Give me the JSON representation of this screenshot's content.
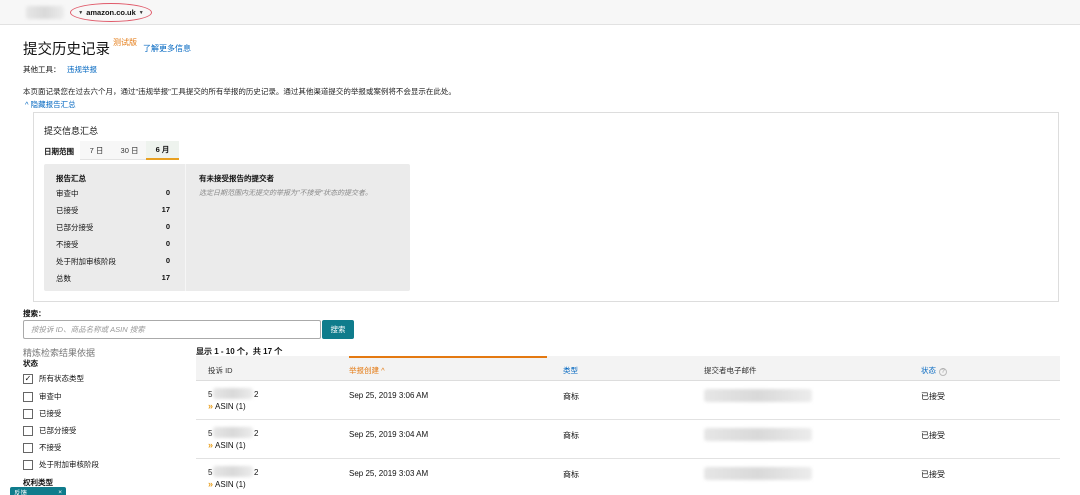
{
  "topbar": {
    "marketplace": "amazon.co.uk"
  },
  "page": {
    "title": "提交历史记录",
    "beta_badge": "测试版",
    "learn_more": "了解更多信息",
    "other_tools_label": "其他工具：",
    "other_tools_link": "违规举报",
    "description": "本页面记录您在过去六个月，通过\"违规举报\"工具提交的所有举报的历史记录。通过其他渠道提交的举报或案例将不会显示在此处。",
    "hide_summary": "隐藏报告汇总"
  },
  "summary": {
    "title": "提交信息汇总",
    "range_label": "日期范围",
    "range_tabs": [
      "7 日",
      "30 日",
      "6 月"
    ],
    "active_range": "6 月",
    "report_summary_title": "报告汇总",
    "rows": [
      {
        "label": "审查中",
        "value": "0"
      },
      {
        "label": "已接受",
        "value": "17"
      },
      {
        "label": "已部分接受",
        "value": "0"
      },
      {
        "label": "不接受",
        "value": "0"
      },
      {
        "label": "处于附加审核阶段",
        "value": "0"
      },
      {
        "label": "总数",
        "value": "17"
      }
    ],
    "non_accept_title": "有未接受报告的提交者",
    "non_accept_note": "选定日期范围内无提交的举报为\"不接受\"状态的提交者。"
  },
  "search": {
    "label": "搜索：",
    "placeholder": "按投诉 ID、商品名称或 ASIN 搜索",
    "button": "搜索"
  },
  "filters": {
    "refine_title": "精炼检索结果依据",
    "status_heading": "状态",
    "options": [
      {
        "label": "所有状态类型",
        "checked": true
      },
      {
        "label": "审查中",
        "checked": false
      },
      {
        "label": "已接受",
        "checked": false
      },
      {
        "label": "已部分接受",
        "checked": false
      },
      {
        "label": "不接受",
        "checked": false
      },
      {
        "label": "处于附加审核阶段",
        "checked": false
      }
    ],
    "rights_heading": "权利类型",
    "chat_tab": "反馈"
  },
  "results": {
    "showing": "显示 1 - 10 个，共 17 个",
    "columns": {
      "id": "投诉 ID",
      "date": "举报创建",
      "type": "类型",
      "email": "提交者电子邮件",
      "status": "状态"
    },
    "rows": [
      {
        "id_prefix": "5",
        "id_suffix": "2",
        "asin": "ASIN (1)",
        "date": "Sep 25, 2019 3:06 AM",
        "type": "商标",
        "status": "已接受"
      },
      {
        "id_prefix": "5",
        "id_suffix": "2",
        "asin": "ASIN (1)",
        "date": "Sep 25, 2019 3:04 AM",
        "type": "商标",
        "status": "已接受"
      },
      {
        "id_prefix": "5",
        "id_suffix": "2",
        "asin": "ASIN (1)",
        "date": "Sep 25, 2019 3:03 AM",
        "type": "商标",
        "status": "已接受"
      }
    ]
  }
}
